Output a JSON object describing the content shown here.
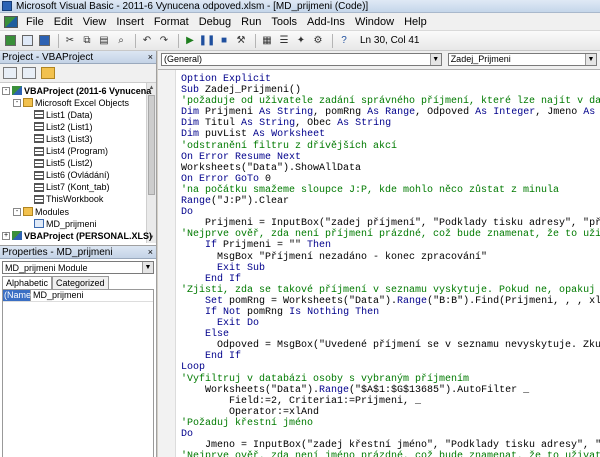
{
  "window": {
    "title": "Microsoft Visual Basic - 2011-6 Vynucena odpoved.xlsm - [MD_prijmeni (Code)]"
  },
  "menu": [
    "File",
    "Edit",
    "View",
    "Insert",
    "Format",
    "Debug",
    "Run",
    "Tools",
    "Add-Ins",
    "Window",
    "Help"
  ],
  "toolbar": {
    "cursor_position": "Ln 30, Col 41"
  },
  "project_panel": {
    "title": "Project - VBAProject",
    "close_glyph": "×",
    "tree": [
      {
        "label": "VBAProject (2011-6 Vynucena",
        "bold": true,
        "icon": "vba",
        "indent": 0,
        "expander": "-"
      },
      {
        "label": "Microsoft Excel Objects",
        "bold": false,
        "icon": "folder",
        "indent": 1,
        "expander": "-"
      },
      {
        "label": "List1 (Data)",
        "bold": false,
        "icon": "sheet",
        "indent": 2,
        "expander": ""
      },
      {
        "label": "List2 (List1)",
        "bold": false,
        "icon": "sheet",
        "indent": 2,
        "expander": ""
      },
      {
        "label": "List3 (List3)",
        "bold": false,
        "icon": "sheet",
        "indent": 2,
        "expander": ""
      },
      {
        "label": "List4 (Program)",
        "bold": false,
        "icon": "sheet",
        "indent": 2,
        "expander": ""
      },
      {
        "label": "List5 (List2)",
        "bold": false,
        "icon": "sheet",
        "indent": 2,
        "expander": ""
      },
      {
        "label": "List6 (Ovládání)",
        "bold": false,
        "icon": "sheet",
        "indent": 2,
        "expander": ""
      },
      {
        "label": "List7 (Kont_tab)",
        "bold": false,
        "icon": "sheet",
        "indent": 2,
        "expander": ""
      },
      {
        "label": "ThisWorkbook",
        "bold": false,
        "icon": "sheet",
        "indent": 2,
        "expander": ""
      },
      {
        "label": "Modules",
        "bold": false,
        "icon": "folder",
        "indent": 1,
        "expander": "-"
      },
      {
        "label": "MD_prijmeni",
        "bold": false,
        "icon": "module",
        "indent": 2,
        "expander": ""
      },
      {
        "label": "VBAProject (PERSONAL.XLS)",
        "bold": true,
        "icon": "vba",
        "indent": 0,
        "expander": "+"
      }
    ]
  },
  "properties_panel": {
    "title": "Properties - MD_prijmeni",
    "close_glyph": "×",
    "object_select": "MD_prijmeni Module",
    "tabs": [
      "Alphabetic",
      "Categorized"
    ],
    "rows": [
      {
        "key": "(Name)",
        "value": "MD_prijmeni"
      }
    ]
  },
  "code_window": {
    "object_dropdown": "(General)",
    "procedure_dropdown": "Zadej_Prijmeni",
    "lines": [
      {
        "i": 0,
        "c": false,
        "t": "Option Explicit"
      },
      {
        "i": 0,
        "c": false,
        "t": "Sub Zadej_Prijmeni()"
      },
      {
        "i": 0,
        "c": true,
        "t": "'požaduje od uživatele zadání správného příjmení, které lze najít v databázi"
      },
      {
        "i": 0,
        "c": false,
        "t": "Dim Prijmeni As String, pomRng As Range, Odpoved As Integer, Jmeno As String"
      },
      {
        "i": 0,
        "c": false,
        "t": "Dim Titul As String, Obec As String"
      },
      {
        "i": 0,
        "c": false,
        "t": "Dim puvList As Worksheet"
      },
      {
        "i": 0,
        "c": true,
        "t": "'odstranění filtru z dřívějších akcí"
      },
      {
        "i": 0,
        "c": false,
        "t": "On Error Resume Next"
      },
      {
        "i": 0,
        "c": false,
        "t": "Worksheets(\"Data\").ShowAllData"
      },
      {
        "i": 0,
        "c": false,
        "t": "On Error GoTo 0"
      },
      {
        "i": 0,
        "c": true,
        "t": "'na počátku smažeme sloupce J:P, kde mohlo něco zůstat z minula"
      },
      {
        "i": 0,
        "c": false,
        "t": "Range(\"J:P\").Clear"
      },
      {
        "i": 0,
        "c": false,
        "t": "Do"
      },
      {
        "i": 4,
        "c": false,
        "t": "Prijmeni = InputBox(\"zadej příjmení\", \"Podklady tisku adresy\", \"příjmení"
      },
      {
        "i": 0,
        "c": true,
        "t": "'Nejprve ověř, zda není příjmení prázdné, což bude znamenat, že to uživatel"
      },
      {
        "i": 4,
        "c": false,
        "t": "If Prijmeni = \"\" Then"
      },
      {
        "i": 6,
        "c": false,
        "t": "MsgBox \"Příjmení nezadáno - konec zpracování\""
      },
      {
        "i": 6,
        "c": false,
        "t": "Exit Sub"
      },
      {
        "i": 4,
        "c": false,
        "t": "End If"
      },
      {
        "i": 0,
        "c": true,
        "t": "'Zjisti, zda se takové příjmení v seznamu vyskytuje. Pokud ne, opakuj"
      },
      {
        "i": 4,
        "c": false,
        "t": "Set pomRng = Worksheets(\"Data\").Range(\"B:B\").Find(Prijmeni, , , xlWhole)"
      },
      {
        "i": 4,
        "c": false,
        "t": "If Not pomRng Is Nothing Then"
      },
      {
        "i": 6,
        "c": false,
        "t": "Exit Do"
      },
      {
        "i": 4,
        "c": false,
        "t": "Else"
      },
      {
        "i": 6,
        "c": false,
        "t": "Odpoved = MsgBox(\"Uvedené příjmení se v seznamu nevyskytuje. Zkuste"
      },
      {
        "i": 4,
        "c": false,
        "t": "End If"
      },
      {
        "i": 0,
        "c": false,
        "t": "Loop"
      },
      {
        "i": 0,
        "c": true,
        "t": "'Vyfiltruj v databázi osoby s vybraným příjmením"
      },
      {
        "i": 4,
        "c": false,
        "t": "Worksheets(\"Data\").Range(\"$A$1:$G$13685\").AutoFilter _"
      },
      {
        "i": 8,
        "c": false,
        "t": "Field:=2, Criteria1:=Prijmeni, _"
      },
      {
        "i": 8,
        "c": false,
        "t": "Operator:=xlAnd"
      },
      {
        "i": 0,
        "c": true,
        "t": "'Požaduj křestní jméno"
      },
      {
        "i": 0,
        "c": false,
        "t": "Do"
      },
      {
        "i": 4,
        "c": false,
        "t": "Jmeno = InputBox(\"zadej křestní jméno\", \"Podklady tisku adresy\", \"jméno\""
      },
      {
        "i": 0,
        "c": true,
        "t": "'Nejprve ověř, zda není jméno prázdné, což bude znamenat, že to uživatel vzd"
      }
    ]
  }
}
